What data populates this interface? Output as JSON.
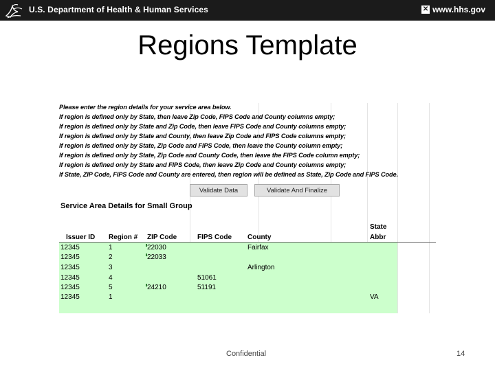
{
  "banner": {
    "department": "U.S. Department of Health & Human Services",
    "site": "www.hhs.gov",
    "background": "#1b1b1b"
  },
  "slide": {
    "title": "Regions Template"
  },
  "instructions": [
    "Please enter the region details for your service area below.",
    "If region is defined only by State, then leave Zip Code, FIPS Code and County columns empty;",
    "If region is defined only by State and Zip Code, then leave FIPS Code and County columns empty;",
    "If region is defined only by State and County, then leave Zip Code and FIPS Code columns empty;",
    "If region is defined only by State, Zip Code and FIPS Code, then leave the County column empty;",
    "If region is defined only by State, Zip Code and County Code, then leave the FIPS Code column empty;",
    "If region is defined only by State and FIPS Code, then leave Zip Code and County columns empty;",
    "If State, ZIP Code, FIPS Code and County are entered, then region will be defined as State, Zip Code and FIPS Code."
  ],
  "buttons": {
    "validate": "Validate Data",
    "validate_finalize": "Validate And Finalize"
  },
  "section_title": "Service Area Details for Small Group",
  "table": {
    "headers": {
      "issuer_id": "Issuer ID",
      "region": "Region #",
      "zip": "ZIP Code",
      "fips": "FIPS Code",
      "county": "County",
      "state_line1": "State",
      "state_line2": "Abbr"
    },
    "rows": [
      {
        "issuer_id": "12345",
        "region": "1",
        "zip": "22030",
        "fips": "",
        "county": "Fairfax",
        "state": ""
      },
      {
        "issuer_id": "12345",
        "region": "2",
        "zip": "22033",
        "fips": "",
        "county": "",
        "state": ""
      },
      {
        "issuer_id": "12345",
        "region": "3",
        "zip": "",
        "fips": "",
        "county": "Arlington",
        "state": ""
      },
      {
        "issuer_id": "12345",
        "region": "4",
        "zip": "",
        "fips": "51061",
        "county": "",
        "state": ""
      },
      {
        "issuer_id": "12345",
        "region": "5",
        "zip": "24210",
        "fips": "51191",
        "county": "",
        "state": ""
      },
      {
        "issuer_id": "12345",
        "region": "1",
        "zip": "",
        "fips": "",
        "county": "",
        "state": "VA"
      }
    ],
    "cell_color": "#ccffcc"
  },
  "footer": {
    "label": "Confidential",
    "page": "14"
  }
}
